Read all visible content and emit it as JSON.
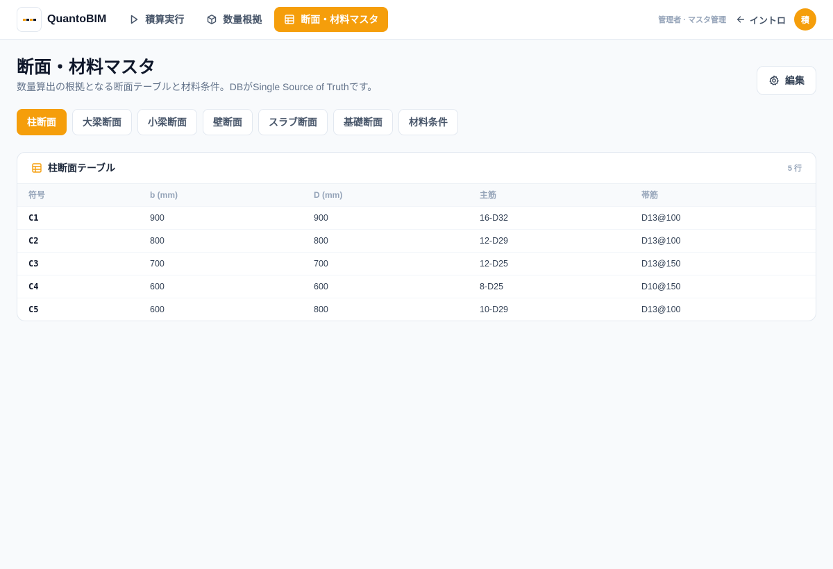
{
  "app": {
    "brand": "QuantoBIM",
    "role_text": "管理者 · マスタ管理",
    "back_label": "イントロ",
    "avatar_initial": "積",
    "accent_color": "#f59e0b"
  },
  "nav": [
    {
      "label": "積算実行",
      "icon": "play-icon",
      "active": false
    },
    {
      "label": "数量根拠",
      "icon": "cube-icon",
      "active": false
    },
    {
      "label": "断面・材料マスタ",
      "icon": "table-icon",
      "active": true
    }
  ],
  "page": {
    "title": "断面・材料マスタ",
    "description": "数量算出の根拠となる断面テーブルと材料条件。DBがSingle Source of Truthです。",
    "edit_label": "編集"
  },
  "tabs": [
    {
      "label": "柱断面",
      "active": true
    },
    {
      "label": "大梁断面",
      "active": false
    },
    {
      "label": "小梁断面",
      "active": false
    },
    {
      "label": "壁断面",
      "active": false
    },
    {
      "label": "スラブ断面",
      "active": false
    },
    {
      "label": "基礎断面",
      "active": false
    },
    {
      "label": "材料条件",
      "active": false
    }
  ],
  "table": {
    "title": "柱断面テーブル",
    "row_count": "5 行",
    "columns": [
      "符号",
      "b (mm)",
      "D (mm)",
      "主筋",
      "帯筋"
    ],
    "rows": [
      [
        "C1",
        "900",
        "900",
        "16-D32",
        "D13@100"
      ],
      [
        "C2",
        "800",
        "800",
        "12-D29",
        "D13@100"
      ],
      [
        "C3",
        "700",
        "700",
        "12-D25",
        "D13@150"
      ],
      [
        "C4",
        "600",
        "600",
        "8-D25",
        "D10@150"
      ],
      [
        "C5",
        "600",
        "800",
        "10-D29",
        "D13@100"
      ]
    ]
  }
}
